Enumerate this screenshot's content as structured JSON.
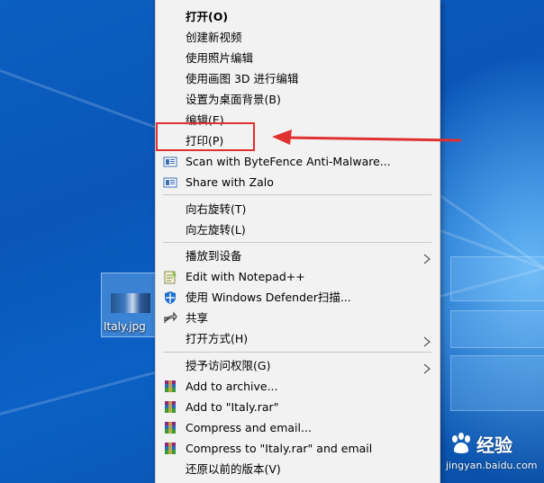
{
  "desktop": {
    "file_icon_label": "Italy.jpg"
  },
  "context_menu": {
    "items": [
      {
        "label": "打开(O)",
        "bold": true
      },
      {
        "label": "创建新视频"
      },
      {
        "label": "使用照片编辑"
      },
      {
        "label": "使用画图 3D 进行编辑"
      },
      {
        "label": "设置为桌面背景(B)"
      },
      {
        "label": "编辑(E)"
      },
      {
        "label": "打印(P)"
      },
      {
        "label": "Scan with ByteFence Anti-Malware...",
        "icon": "bytefence-icon"
      },
      {
        "label": "Share with Zalo",
        "icon": "zalo-icon"
      },
      {
        "label": "向右旋转(T)"
      },
      {
        "label": "向左旋转(L)"
      },
      {
        "label": "播放到设备",
        "submenu": true
      },
      {
        "label": "Edit with Notepad++",
        "icon": "notepadpp-icon"
      },
      {
        "label": "使用 Windows Defender扫描...",
        "icon": "windows-defender-icon"
      },
      {
        "label": "共享",
        "icon": "share-icon"
      },
      {
        "label": "打开方式(H)",
        "submenu": true
      },
      {
        "label": "授予访问权限(G)",
        "submenu": true
      },
      {
        "label": "Add to archive...",
        "icon": "winrar-icon"
      },
      {
        "label": "Add to \"Italy.rar\"",
        "icon": "winrar-icon"
      },
      {
        "label": "Compress and email...",
        "icon": "winrar-icon"
      },
      {
        "label": "Compress to \"Italy.rar\" and email",
        "icon": "winrar-icon"
      },
      {
        "label": "还原以前的版本(V)"
      }
    ]
  },
  "annotation": {
    "highlight_color": "#e0302f"
  },
  "watermark": {
    "brand": "经验",
    "url": "jingyan.baidu.com",
    "logo_text": "Bai du"
  }
}
